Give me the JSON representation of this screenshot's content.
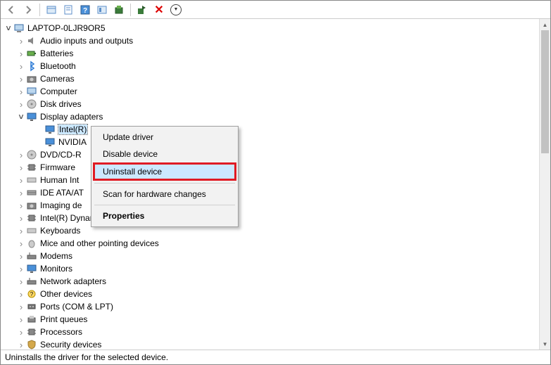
{
  "toolbar": {
    "back": "Back",
    "forward": "Forward",
    "show_hidden": "Show hidden devices",
    "properties": "Properties",
    "help": "Help",
    "scan": "Scan for hardware changes",
    "update": "Update driver",
    "uninstall": "Uninstall device",
    "disable": "Disable device",
    "enable": "Enable device"
  },
  "root": {
    "label": "LAPTOP-0LJR9OR5"
  },
  "categories": [
    {
      "label": "Audio inputs and outputs",
      "icon": "audio-icon",
      "expanded": false
    },
    {
      "label": "Batteries",
      "icon": "battery-icon",
      "expanded": false
    },
    {
      "label": "Bluetooth",
      "icon": "bluetooth-icon",
      "expanded": false
    },
    {
      "label": "Cameras",
      "icon": "camera-icon",
      "expanded": false
    },
    {
      "label": "Computer",
      "icon": "computer-icon",
      "expanded": false
    },
    {
      "label": "Disk drives",
      "icon": "disk-icon",
      "expanded": false
    },
    {
      "label": "Display adapters",
      "icon": "display-icon",
      "expanded": true,
      "children": [
        {
          "label": "Intel(R)",
          "icon": "display-icon",
          "selected": true
        },
        {
          "label": "NVIDIA",
          "icon": "display-icon",
          "selected": false
        }
      ]
    },
    {
      "label": "DVD/CD-R",
      "icon": "optical-icon",
      "expanded": false
    },
    {
      "label": "Firmware",
      "icon": "firmware-icon",
      "expanded": false
    },
    {
      "label": "Human Int",
      "icon": "hid-icon",
      "expanded": false
    },
    {
      "label": "IDE ATA/AT",
      "icon": "ide-icon",
      "expanded": false
    },
    {
      "label": "Imaging de",
      "icon": "imaging-icon",
      "expanded": false
    },
    {
      "label": "Intel(R) Dynamic Platform and Thermal Framework",
      "icon": "chip-icon",
      "expanded": false
    },
    {
      "label": "Keyboards",
      "icon": "keyboard-icon",
      "expanded": false
    },
    {
      "label": "Mice and other pointing devices",
      "icon": "mouse-icon",
      "expanded": false
    },
    {
      "label": "Modems",
      "icon": "modem-icon",
      "expanded": false
    },
    {
      "label": "Monitors",
      "icon": "monitor-icon",
      "expanded": false
    },
    {
      "label": "Network adapters",
      "icon": "network-icon",
      "expanded": false
    },
    {
      "label": "Other devices",
      "icon": "other-icon",
      "expanded": false
    },
    {
      "label": "Ports (COM & LPT)",
      "icon": "port-icon",
      "expanded": false
    },
    {
      "label": "Print queues",
      "icon": "printer-icon",
      "expanded": false
    },
    {
      "label": "Processors",
      "icon": "cpu-icon",
      "expanded": false
    },
    {
      "label": "Security devices",
      "icon": "security-icon",
      "expanded": false
    }
  ],
  "context_menu": {
    "items": [
      {
        "label": "Update driver",
        "bold": false,
        "highlighted": false
      },
      {
        "label": "Disable device",
        "bold": false,
        "highlighted": false
      },
      {
        "label": "Uninstall device",
        "bold": false,
        "highlighted": true,
        "hovered": true
      },
      {
        "separator": true
      },
      {
        "label": "Scan for hardware changes",
        "bold": false,
        "highlighted": false
      },
      {
        "separator": true
      },
      {
        "label": "Properties",
        "bold": true,
        "highlighted": false
      }
    ]
  },
  "status_bar": {
    "text": "Uninstalls the driver for the selected device."
  }
}
